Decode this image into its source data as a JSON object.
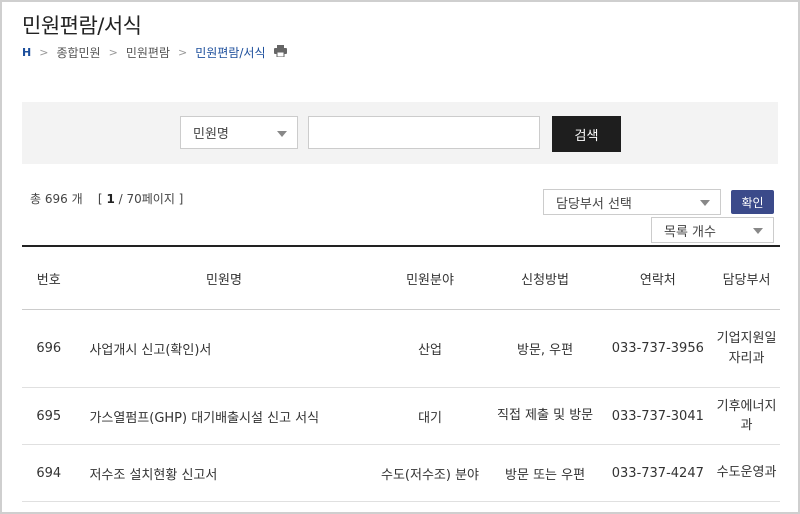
{
  "page": {
    "title": "민원편람/서식"
  },
  "breadcrumb": {
    "home": "H",
    "items": [
      "종합민원",
      "민원편람",
      "민원편람/서식"
    ]
  },
  "search": {
    "field_selected": "민원명",
    "query_value": "",
    "button_label": "검색"
  },
  "summary": {
    "total_prefix": "총",
    "total_count": "696",
    "total_suffix": "개",
    "page_open": "[",
    "page_current": "1",
    "page_rest": " / 70페이지 ]"
  },
  "filters": {
    "department_selected": "담당부서 선택",
    "confirm_label": "확인",
    "list_count_selected": "목록 개수"
  },
  "table": {
    "headers": [
      "번호",
      "민원명",
      "민원분야",
      "신청방법",
      "연락처",
      "담당부서"
    ],
    "rows": [
      {
        "no": "696",
        "name": "사업개시 신고(확인)서",
        "field": "산업",
        "method": "방문, 우편",
        "contact": "033-737-3956",
        "dept": "기업지원일자리과"
      },
      {
        "no": "695",
        "name": "가스열펌프(GHP) 대기배출시설 신고 서식",
        "field": "대기",
        "method": "직접 제출 및 방문",
        "contact": "033-737-3041",
        "dept": "기후에너지과"
      },
      {
        "no": "694",
        "name": "저수조 설치현황 신고서",
        "field": "수도(저수조) 분야",
        "method": "방문 또는 우편",
        "contact": "033-737-4247",
        "dept": "수도운영과"
      }
    ]
  }
}
